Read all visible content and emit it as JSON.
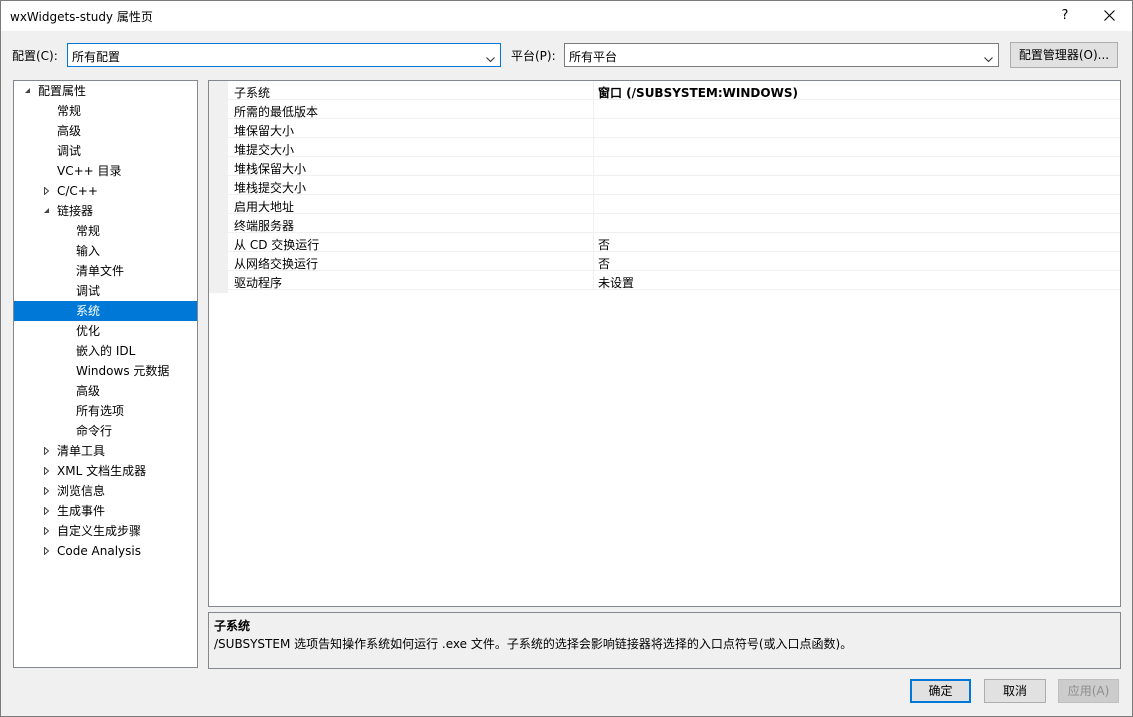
{
  "window": {
    "title": "wxWidgets-study 属性页",
    "help_label": "?",
    "close_icon": "close-icon"
  },
  "toolbar": {
    "config_label": "配置(C):",
    "config_value": "所有配置",
    "platform_label": "平台(P):",
    "platform_value": "所有平台",
    "config_manager_label": "配置管理器(O)..."
  },
  "tree": {
    "items": [
      {
        "label": "配置属性",
        "expander": "expanded"
      },
      {
        "label": "常规",
        "expander": "none"
      },
      {
        "label": "高级",
        "expander": "none"
      },
      {
        "label": "调试",
        "expander": "none"
      },
      {
        "label": "VC++ 目录",
        "expander": "none"
      },
      {
        "label": "C/C++",
        "expander": "collapsed"
      },
      {
        "label": "链接器",
        "expander": "expanded"
      },
      {
        "label": "常规",
        "expander": "none"
      },
      {
        "label": "输入",
        "expander": "none"
      },
      {
        "label": "清单文件",
        "expander": "none"
      },
      {
        "label": "调试",
        "expander": "none"
      },
      {
        "label": "系统",
        "expander": "none",
        "selected": true
      },
      {
        "label": "优化",
        "expander": "none"
      },
      {
        "label": "嵌入的 IDL",
        "expander": "none"
      },
      {
        "label": "Windows 元数据",
        "expander": "none"
      },
      {
        "label": "高级",
        "expander": "none"
      },
      {
        "label": "所有选项",
        "expander": "none"
      },
      {
        "label": "命令行",
        "expander": "none"
      },
      {
        "label": "清单工具",
        "expander": "collapsed"
      },
      {
        "label": "XML 文档生成器",
        "expander": "collapsed"
      },
      {
        "label": "浏览信息",
        "expander": "collapsed"
      },
      {
        "label": "生成事件",
        "expander": "collapsed"
      },
      {
        "label": "自定义生成步骤",
        "expander": "collapsed"
      },
      {
        "label": "Code Analysis",
        "expander": "collapsed"
      }
    ]
  },
  "properties": [
    {
      "name": "子系统",
      "value": "窗口 (/SUBSYSTEM:WINDOWS)"
    },
    {
      "name": "所需的最低版本",
      "value": ""
    },
    {
      "name": "堆保留大小",
      "value": ""
    },
    {
      "name": "堆提交大小",
      "value": ""
    },
    {
      "name": "堆栈保留大小",
      "value": ""
    },
    {
      "name": "堆栈提交大小",
      "value": ""
    },
    {
      "name": "启用大地址",
      "value": ""
    },
    {
      "name": "终端服务器",
      "value": ""
    },
    {
      "name": "从 CD 交换运行",
      "value": "否"
    },
    {
      "name": "从网络交换运行",
      "value": "否"
    },
    {
      "name": "驱动程序",
      "value": "未设置"
    }
  ],
  "description": {
    "title": "子系统",
    "text": "/SUBSYSTEM 选项告知操作系统如何运行 .exe 文件。子系统的选择会影响链接器将选择的入口点符号(或入口点函数)。"
  },
  "buttons": {
    "ok": "确定",
    "cancel": "取消",
    "apply": "应用(A)"
  },
  "colors": {
    "accent": "#0078d7",
    "window_bg": "#f0f0f0",
    "panel_bg": "#ffffff"
  }
}
